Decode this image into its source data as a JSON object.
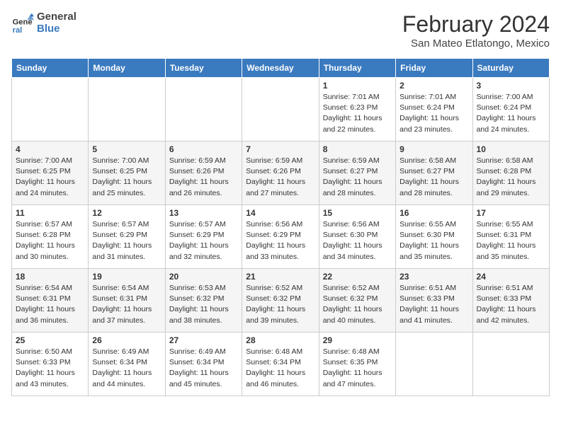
{
  "logo": {
    "line1": "General",
    "line2": "Blue"
  },
  "title": "February 2024",
  "location": "San Mateo Etlatongo, Mexico",
  "weekdays": [
    "Sunday",
    "Monday",
    "Tuesday",
    "Wednesday",
    "Thursday",
    "Friday",
    "Saturday"
  ],
  "weeks": [
    [
      {
        "day": "",
        "info": ""
      },
      {
        "day": "",
        "info": ""
      },
      {
        "day": "",
        "info": ""
      },
      {
        "day": "",
        "info": ""
      },
      {
        "day": "1",
        "info": "Sunrise: 7:01 AM\nSunset: 6:23 PM\nDaylight: 11 hours\nand 22 minutes."
      },
      {
        "day": "2",
        "info": "Sunrise: 7:01 AM\nSunset: 6:24 PM\nDaylight: 11 hours\nand 23 minutes."
      },
      {
        "day": "3",
        "info": "Sunrise: 7:00 AM\nSunset: 6:24 PM\nDaylight: 11 hours\nand 24 minutes."
      }
    ],
    [
      {
        "day": "4",
        "info": "Sunrise: 7:00 AM\nSunset: 6:25 PM\nDaylight: 11 hours\nand 24 minutes."
      },
      {
        "day": "5",
        "info": "Sunrise: 7:00 AM\nSunset: 6:25 PM\nDaylight: 11 hours\nand 25 minutes."
      },
      {
        "day": "6",
        "info": "Sunrise: 6:59 AM\nSunset: 6:26 PM\nDaylight: 11 hours\nand 26 minutes."
      },
      {
        "day": "7",
        "info": "Sunrise: 6:59 AM\nSunset: 6:26 PM\nDaylight: 11 hours\nand 27 minutes."
      },
      {
        "day": "8",
        "info": "Sunrise: 6:59 AM\nSunset: 6:27 PM\nDaylight: 11 hours\nand 28 minutes."
      },
      {
        "day": "9",
        "info": "Sunrise: 6:58 AM\nSunset: 6:27 PM\nDaylight: 11 hours\nand 28 minutes."
      },
      {
        "day": "10",
        "info": "Sunrise: 6:58 AM\nSunset: 6:28 PM\nDaylight: 11 hours\nand 29 minutes."
      }
    ],
    [
      {
        "day": "11",
        "info": "Sunrise: 6:57 AM\nSunset: 6:28 PM\nDaylight: 11 hours\nand 30 minutes."
      },
      {
        "day": "12",
        "info": "Sunrise: 6:57 AM\nSunset: 6:29 PM\nDaylight: 11 hours\nand 31 minutes."
      },
      {
        "day": "13",
        "info": "Sunrise: 6:57 AM\nSunset: 6:29 PM\nDaylight: 11 hours\nand 32 minutes."
      },
      {
        "day": "14",
        "info": "Sunrise: 6:56 AM\nSunset: 6:29 PM\nDaylight: 11 hours\nand 33 minutes."
      },
      {
        "day": "15",
        "info": "Sunrise: 6:56 AM\nSunset: 6:30 PM\nDaylight: 11 hours\nand 34 minutes."
      },
      {
        "day": "16",
        "info": "Sunrise: 6:55 AM\nSunset: 6:30 PM\nDaylight: 11 hours\nand 35 minutes."
      },
      {
        "day": "17",
        "info": "Sunrise: 6:55 AM\nSunset: 6:31 PM\nDaylight: 11 hours\nand 35 minutes."
      }
    ],
    [
      {
        "day": "18",
        "info": "Sunrise: 6:54 AM\nSunset: 6:31 PM\nDaylight: 11 hours\nand 36 minutes."
      },
      {
        "day": "19",
        "info": "Sunrise: 6:54 AM\nSunset: 6:31 PM\nDaylight: 11 hours\nand 37 minutes."
      },
      {
        "day": "20",
        "info": "Sunrise: 6:53 AM\nSunset: 6:32 PM\nDaylight: 11 hours\nand 38 minutes."
      },
      {
        "day": "21",
        "info": "Sunrise: 6:52 AM\nSunset: 6:32 PM\nDaylight: 11 hours\nand 39 minutes."
      },
      {
        "day": "22",
        "info": "Sunrise: 6:52 AM\nSunset: 6:32 PM\nDaylight: 11 hours\nand 40 minutes."
      },
      {
        "day": "23",
        "info": "Sunrise: 6:51 AM\nSunset: 6:33 PM\nDaylight: 11 hours\nand 41 minutes."
      },
      {
        "day": "24",
        "info": "Sunrise: 6:51 AM\nSunset: 6:33 PM\nDaylight: 11 hours\nand 42 minutes."
      }
    ],
    [
      {
        "day": "25",
        "info": "Sunrise: 6:50 AM\nSunset: 6:33 PM\nDaylight: 11 hours\nand 43 minutes."
      },
      {
        "day": "26",
        "info": "Sunrise: 6:49 AM\nSunset: 6:34 PM\nDaylight: 11 hours\nand 44 minutes."
      },
      {
        "day": "27",
        "info": "Sunrise: 6:49 AM\nSunset: 6:34 PM\nDaylight: 11 hours\nand 45 minutes."
      },
      {
        "day": "28",
        "info": "Sunrise: 6:48 AM\nSunset: 6:34 PM\nDaylight: 11 hours\nand 46 minutes."
      },
      {
        "day": "29",
        "info": "Sunrise: 6:48 AM\nSunset: 6:35 PM\nDaylight: 11 hours\nand 47 minutes."
      },
      {
        "day": "",
        "info": ""
      },
      {
        "day": "",
        "info": ""
      }
    ]
  ]
}
